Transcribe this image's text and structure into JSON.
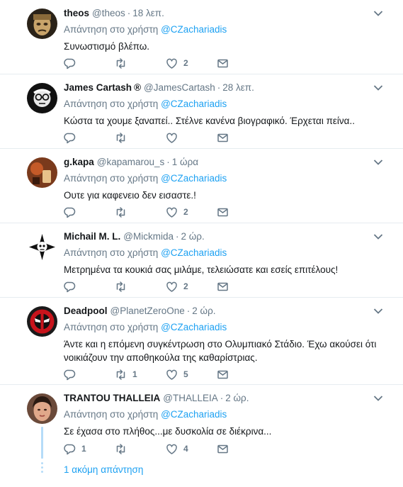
{
  "tweets": [
    {
      "name": "theos",
      "badge": "",
      "handle": "@theos",
      "time": "18 λεπ.",
      "reply_label": "Απάντηση στο χρήστη",
      "mention": "@CZachariadis",
      "lines": [
        "Συνωστισμό βλέπω."
      ],
      "replies": "",
      "retweets": "",
      "likes": "2"
    },
    {
      "name": "James Cartash",
      "badge": "®",
      "handle": "@JamesCartash",
      "time": "28 λεπ.",
      "reply_label": "Απάντηση στο χρήστη",
      "mention": "@CZachariadis",
      "lines": [
        "Κώστα τα χουμε ξαναπεί.. Στέλνε κανένα βιογραφικό. Έρχεται πείνα.."
      ],
      "replies": "",
      "retweets": "",
      "likes": ""
    },
    {
      "name": "g.kapa",
      "badge": "",
      "handle": "@kapamarou_s",
      "time": "1 ώρα",
      "reply_label": "Απάντηση στο χρήστη",
      "mention": "@CZachariadis",
      "lines": [
        "Ουτε για καφενειο δεν εισαστε.!"
      ],
      "replies": "",
      "retweets": "",
      "likes": "2"
    },
    {
      "name": "Michail M. L.",
      "badge": "",
      "handle": "@Mickmida",
      "time": "2 ώρ.",
      "reply_label": "Απάντηση στο χρήστη",
      "mention": "@CZachariadis",
      "lines": [
        "Μετρημένα τα κουκιά σας μιλάμε, τελειώσατε και εσείς επιτέλους!"
      ],
      "replies": "",
      "retweets": "",
      "likes": "2"
    },
    {
      "name": "Deadpool",
      "badge": "",
      "handle": "@PlanetZeroOne",
      "time": "2 ώρ.",
      "reply_label": "Απάντηση στο χρήστη",
      "mention": "@CZachariadis",
      "lines": [
        "Άντε και η επόμενη συγκέντρωση στο Ολυμπιακό Στάδιο. Έχω ακούσει ότι",
        "νοικιάζουν την αποθηκούλα της καθαρίστριας."
      ],
      "replies": "",
      "retweets": "1",
      "likes": "5"
    },
    {
      "name": "TRANTOU THALLEIA",
      "badge": "",
      "handle": "@THALLEIA",
      "time": "2 ώρ.",
      "reply_label": "Απάντηση στο χρήστη",
      "mention": "@CZachariadis",
      "lines": [
        "Σε έχασα στο πλήθος...με δυσκολία σε διέκρινα..."
      ],
      "replies": "1",
      "retweets": "",
      "likes": "4"
    }
  ],
  "more_replies": "1 ακόμη απάντηση",
  "colors": {
    "accent": "#1da1f2",
    "muted": "#657786",
    "border": "#e6ecf0"
  },
  "icons": [
    "reply-icon",
    "retweet-icon",
    "like-icon",
    "direct-message-icon",
    "chevron-down-icon"
  ]
}
